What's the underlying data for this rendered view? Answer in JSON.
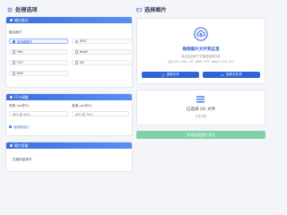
{
  "left": {
    "heading": "处理选项",
    "output_section": {
      "title": "输出格式",
      "label": "输出格式",
      "formats": [
        {
          "label": "保持原格式",
          "selected": true
        },
        {
          "label": "JPEG",
          "selected": false
        },
        {
          "label": "PNG",
          "selected": false
        },
        {
          "label": "WebP",
          "selected": false
        },
        {
          "label": "TIFF",
          "selected": false
        },
        {
          "label": "GIF",
          "selected": false
        },
        {
          "label": "BMP",
          "selected": false
        }
      ]
    },
    "size_section": {
      "title": "尺寸调整",
      "width_label": "宽度 (px或%)",
      "height_label": "高度 (px或%)",
      "width_value": "800 或 50%",
      "height_value": "600 或 75%",
      "keep_ratio_label": "保持宽高比"
    },
    "quality_section": {
      "title": "图片质量",
      "hint": "压缩质量调节"
    }
  },
  "right": {
    "heading": "选择图片",
    "upload": {
      "title": "拖拽图片文件到这里",
      "subtitle": "或点击选择下方按钮选择文件",
      "formats_hint": "支持 JPG, PNG, GIF, BMP, TIFF, WebP, SVG, ICO",
      "select_files_label": "选择文件",
      "select_folder_label": "选择文件夹"
    },
    "selected": {
      "text": "已选择 (0) 文件",
      "sub": "文件列表"
    },
    "start_button_label": "开始处理图片文件"
  },
  "colors": {
    "accent": "#2f63d8",
    "start_button": "#7fd1a8",
    "background": "#f4f5f8"
  }
}
